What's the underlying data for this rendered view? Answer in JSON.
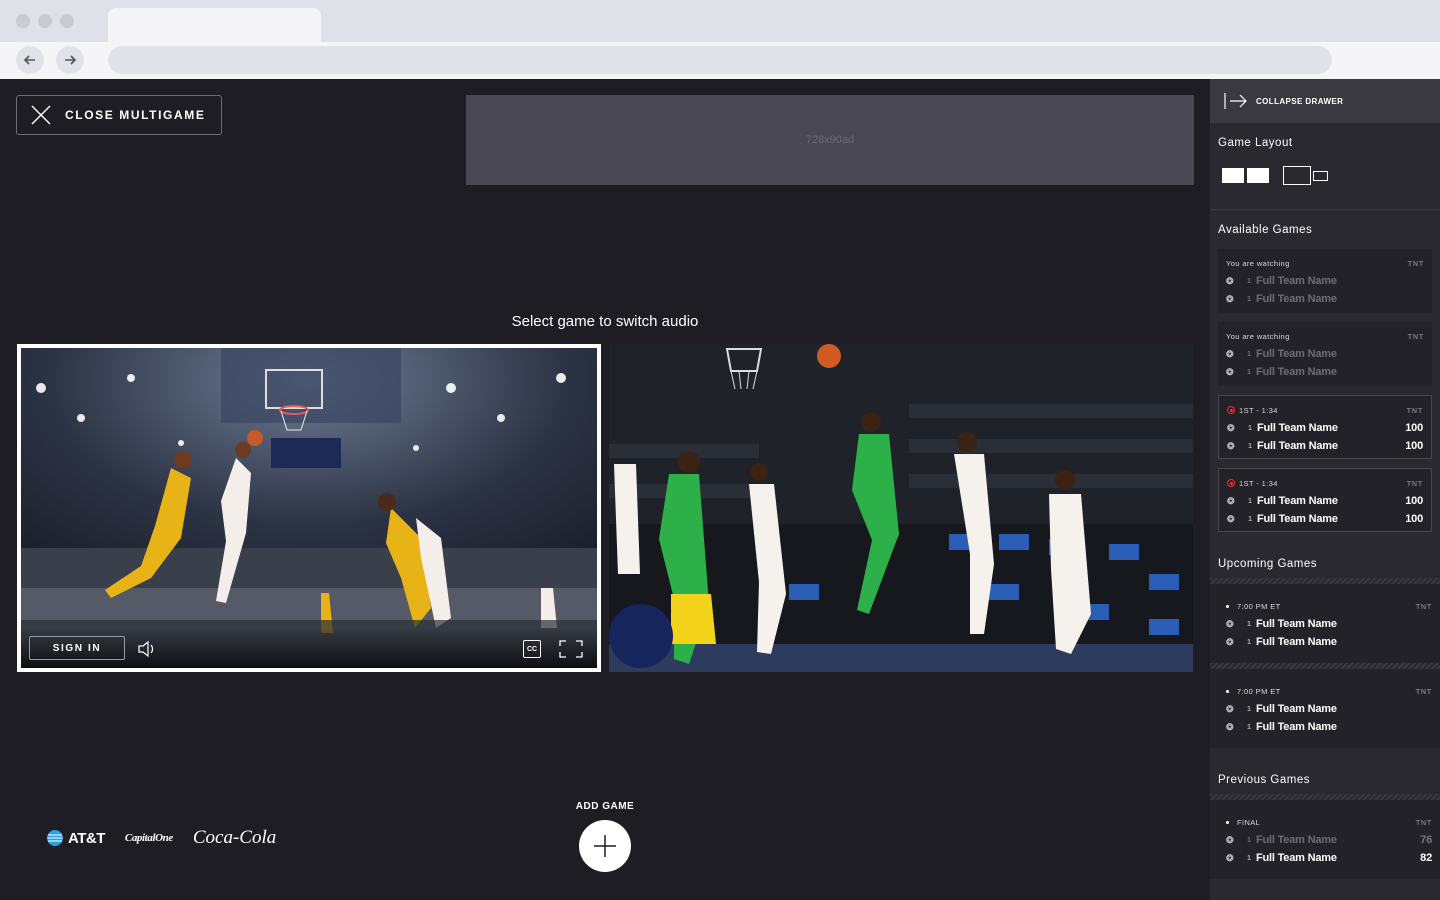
{
  "browser": {
    "url": ""
  },
  "main": {
    "close_label": "CLOSE MULTIGAME",
    "ad_label": "728x90ad",
    "select_text": "Select game to switch audio",
    "player": {
      "signin_label": "SIGN IN",
      "cc_label": "CC"
    },
    "add_game_label": "ADD GAME",
    "sponsors": {
      "att": "AT&T",
      "capitalone": "CapitalOne",
      "cocacola": "Coca-Cola"
    }
  },
  "drawer": {
    "collapse_label": "COLLAPSE DRAWER",
    "game_layout_title": "Game Layout",
    "available_title": "Available Games",
    "upcoming_title": "Upcoming Games",
    "previous_title": "Previous Games",
    "available": [
      {
        "status": "You are watching",
        "network": "TNT",
        "teams": [
          {
            "seed": "1",
            "name": "Full Team Name",
            "score": ""
          },
          {
            "seed": "1",
            "name": "Full Team Name",
            "score": ""
          }
        ]
      },
      {
        "status": "You are watching",
        "network": "TNT",
        "teams": [
          {
            "seed": "1",
            "name": "Full Team Name",
            "score": ""
          },
          {
            "seed": "1",
            "name": "Full Team Name",
            "score": ""
          }
        ]
      },
      {
        "status": "1ST - 1:34",
        "network": "TNT",
        "teams": [
          {
            "seed": "1",
            "name": "Full Team Name",
            "score": "100"
          },
          {
            "seed": "1",
            "name": "Full Team Name",
            "score": "100"
          }
        ]
      },
      {
        "status": "1ST - 1:34",
        "network": "TNT",
        "teams": [
          {
            "seed": "1",
            "name": "Full Team Name",
            "score": "100"
          },
          {
            "seed": "1",
            "name": "Full Team Name",
            "score": "100"
          }
        ]
      }
    ],
    "upcoming": [
      {
        "status": "7:00 PM ET",
        "network": "TNT",
        "teams": [
          {
            "seed": "1",
            "name": "Full Team Name"
          },
          {
            "seed": "1",
            "name": "Full Team Name"
          }
        ]
      },
      {
        "status": "7:00 PM ET",
        "network": "TNT",
        "teams": [
          {
            "seed": "1",
            "name": "Full Team Name"
          },
          {
            "seed": "1",
            "name": "Full Team Name"
          }
        ]
      }
    ],
    "previous": [
      {
        "status": "FINAL",
        "network": "TNT",
        "teams": [
          {
            "seed": "1",
            "name": "Full Team Name",
            "score": "76"
          },
          {
            "seed": "1",
            "name": "Full Team Name",
            "score": "82"
          }
        ]
      }
    ]
  }
}
